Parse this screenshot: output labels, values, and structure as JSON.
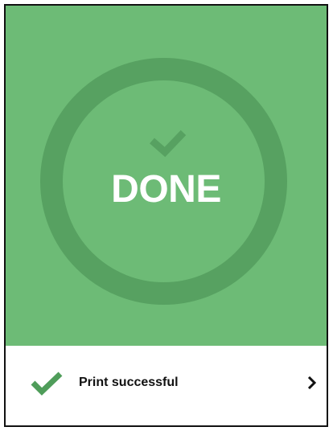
{
  "status": {
    "hero_label": "DONE",
    "message": "Print successful"
  },
  "colors": {
    "hero_background": "#6dbb76",
    "ring": "#57a161",
    "check_hero": "#57a161",
    "check_footer": "#4f9d5a"
  },
  "icons": {
    "hero": "checkmark-icon",
    "footer": "checkmark-icon",
    "action": "chevron-right-icon"
  }
}
